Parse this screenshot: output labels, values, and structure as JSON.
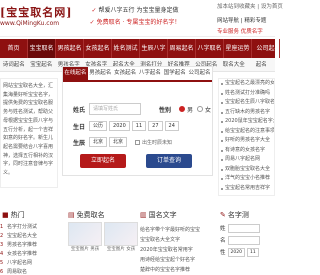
{
  "header": {
    "logo_text": "[宝宝取名网]",
    "logo_url": "www.QiMingKu.com",
    "slogan_line1": "帮爱八字五行 为宝宝量身定做",
    "slogan_line2": "免费取名 · 专属宝宝的好名字！",
    "favorites": "加本站到收藏夹 | 设为首页",
    "hot_links": "网站导航 | 精彩专题",
    "service": "专业服务 优质名字"
  },
  "nav": [
    "首页",
    "宝宝取名",
    "男孩起名",
    "女孩起名",
    "姓名测试",
    "生辰八字",
    "周易起名",
    "八字取名",
    "星座运势",
    "公司起"
  ],
  "subnav": [
    "诗词起名",
    "宝宝起名",
    "男孩名字",
    "女孩名字",
    "起名大全",
    "测名打分",
    "好名推荐",
    "公司起名",
    "取名大全",
    "起名"
  ],
  "left_article": "网站宝宝取名大全，汇集海量好听宝宝名字，提供免费的宝宝取名服务与姓名测试，帮助父母根据宝宝生辰八字与五行分析，起一个吉祥如意的好名字。新生儿起名需要结合八字喜用神，选择五行相补的汉字，同时注意音律与字义。",
  "form": {
    "tabs": [
      "在线起名",
      "男孩起名",
      "女孩起名",
      "八字起名",
      "国学起名",
      "公司起名"
    ],
    "surname_label": "姓氏",
    "surname_placeholder": "请填写姓氏",
    "gender_label": "性别",
    "gender_options": [
      "男",
      "女"
    ],
    "birth_label": "生日",
    "birth_calendar": "公历",
    "birth_year": "2020",
    "birth_month": "11",
    "birth_day": "27",
    "birth_hour": "24",
    "birthplace_label": "生辰",
    "birth_province": "北京",
    "birth_city": "北京",
    "unknown_time_label": "出生时辰未知",
    "submit_label": "立即起名",
    "order_label": "订单查询"
  },
  "right_list": [
    "宝宝起名之最漂亮的女孩名字",
    "姓名测试打分准确吗",
    "宝宝起名生辰八字取名",
    "五行缺木的男孩名字",
    "2020鼠年宝宝起名字大全",
    "给宝宝起名的注意事项",
    "好听的男孩名字大全",
    "有诗意的女孩名字",
    "周易八字起名网",
    "双胞胎宝宝取名大全",
    "洋气的宝宝小名推荐",
    "宝宝起名常用吉祥字"
  ],
  "sections": {
    "hot": "热门",
    "free": "免费取名",
    "news": "国名文字",
    "test": "名字测"
  },
  "left_bottom_list": [
    "名字打分测试",
    "宝宝起名大全",
    "男孩名字推荐",
    "女孩名字推荐",
    "八字起名网",
    "周易取名",
    "公司名字大全"
  ],
  "thumbs": [
    "宝宝图片 男孩",
    "宝宝图片 女孩"
  ],
  "news_list": [
    "给名字带个字最好听的宝宝",
    "宝宝取名大全文字",
    "2020年宝宝取名常用字",
    "用诗经给宝宝起个好名字",
    "楚辞中的宝宝名字推荐"
  ],
  "test_form": {
    "surname_label": "姓",
    "name_label": "名",
    "gender_label": "性",
    "year": "2020",
    "month": "11"
  }
}
